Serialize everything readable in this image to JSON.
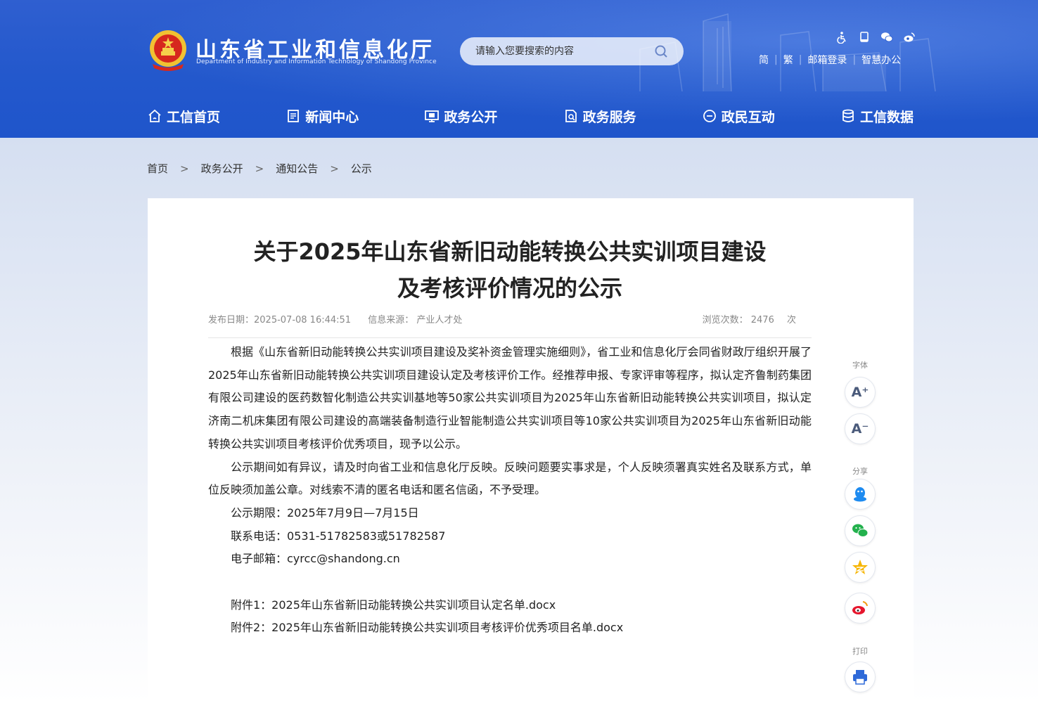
{
  "header": {
    "site_title": "山东省工业和信息化厅",
    "site_subtitle": "Department of Industry and Information Technology of Shandong Province",
    "search_placeholder": "请输入您要搜索的内容",
    "top_links": {
      "simplified": "简",
      "traditional": "繁",
      "mail_login": "邮箱登录",
      "smart_office": "智慧办公"
    },
    "top_icons": [
      "accessibility-icon",
      "mobile-icon",
      "wechat-icon",
      "weibo-icon"
    ]
  },
  "nav": [
    {
      "label": "工信首页",
      "icon": "home-icon"
    },
    {
      "label": "新闻中心",
      "icon": "news-icon"
    },
    {
      "label": "政务公开",
      "icon": "monitor-icon"
    },
    {
      "label": "政务服务",
      "icon": "service-icon"
    },
    {
      "label": "政民互动",
      "icon": "chat-icon"
    },
    {
      "label": "工信数据",
      "icon": "database-icon"
    }
  ],
  "breadcrumb": [
    "首页",
    "政务公开",
    "通知公告",
    "公示"
  ],
  "breadcrumb_sep": ">",
  "article": {
    "title_line1": "关于2025年山东省新旧动能转换公共实训项目建设",
    "title_line2": "及考核评价情况的公示",
    "publish_date": "发布日期：2025-07-08 16:44:51",
    "source": "信息来源： 产业人才处",
    "views_label": "浏览次数：",
    "views_count": "2476",
    "views_unit": "次",
    "paragraph1": "根据《山东省新旧动能转换公共实训项目建设及奖补资金管理实施细则》，省工业和信息化厅会同省财政厅组织开展了2025年山东省新旧动能转换公共实训项目建设认定及考核评价工作。经推荐申报、专家评审等程序，拟认定齐鲁制药集团有限公司建设的医药数智化制造公共实训基地等50家公共实训项目为2025年山东省新旧动能转换公共实训项目，拟认定济南二机床集团有限公司建设的高端装备制造行业智能制造公共实训项目等10家公共实训项目为2025年山东省新旧动能转换公共实训项目考核评价优秀项目，现予以公示。",
    "paragraph2": "公示期间如有异议，请及时向省工业和信息化厅反映。反映问题要实事求是，个人反映须署真实姓名及联系方式，单位反映须加盖公章。对线索不清的匿名电话和匿名信函，不予受理。",
    "period": "公示期限：2025年7月9日—7月15日",
    "phone": "联系电话：0531-51782583或51782587",
    "email": "电子邮箱：cyrcc@shandong.cn",
    "attachment1": "附件1：2025年山东省新旧动能转换公共实训项目认定名单.docx",
    "attachment2": "附件2：2025年山东省新旧动能转换公共实训项目考核评价优秀项目名单.docx"
  },
  "side_tools": {
    "font_label": "字体",
    "font_increase": "A⁺",
    "font_decrease": "A⁻",
    "share_label": "分享",
    "print_label": "打印"
  },
  "colors": {
    "header_blue": "#2358cc",
    "qq_blue": "#1e8bf0",
    "wechat_green": "#23b14d",
    "qzone_yellow": "#f6b500",
    "weibo_red": "#e6162d",
    "print_blue": "#2f6ad8"
  }
}
